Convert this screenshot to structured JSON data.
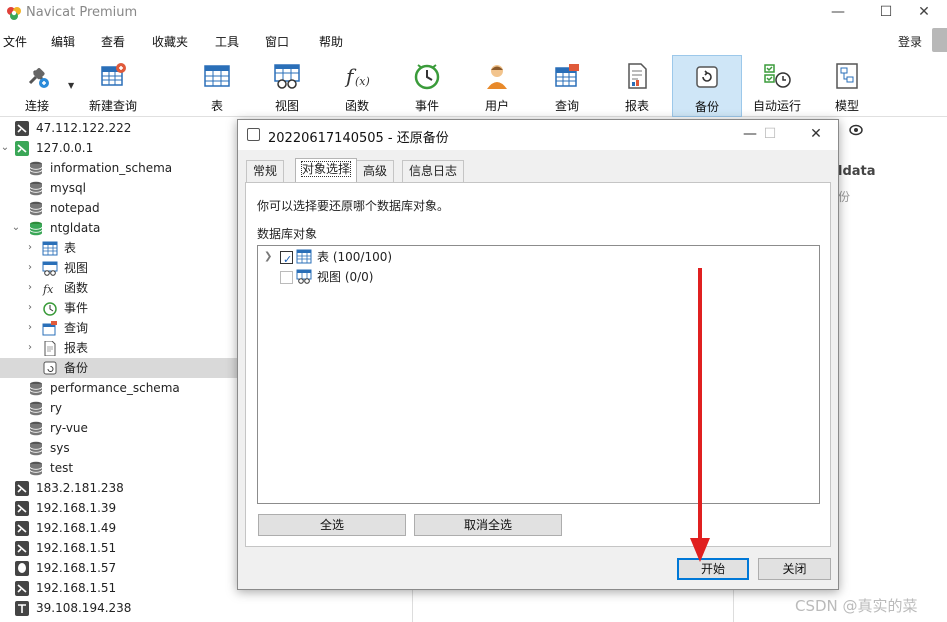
{
  "app": {
    "title": "Navicat Premium"
  },
  "window_controls": {
    "minimize": "—",
    "maximize": "☐",
    "close": "✕"
  },
  "menu": [
    "文件",
    "编辑",
    "查看",
    "收藏夹",
    "工具",
    "窗口",
    "帮助"
  ],
  "login": "登录",
  "toolbar": [
    {
      "label": "连接",
      "icon": "connect-icon"
    },
    {
      "label": "新建查询",
      "icon": "new-query-icon"
    },
    {
      "label": "表",
      "icon": "table-icon"
    },
    {
      "label": "视图",
      "icon": "view-icon"
    },
    {
      "label": "函数",
      "icon": "function-icon"
    },
    {
      "label": "事件",
      "icon": "event-icon"
    },
    {
      "label": "用户",
      "icon": "user-icon"
    },
    {
      "label": "查询",
      "icon": "query-icon"
    },
    {
      "label": "报表",
      "icon": "report-icon"
    },
    {
      "label": "备份",
      "icon": "backup-icon",
      "active": true
    },
    {
      "label": "自动运行",
      "icon": "automation-icon"
    },
    {
      "label": "模型",
      "icon": "model-icon"
    }
  ],
  "sidebar": {
    "items": [
      {
        "label": "47.112.122.222",
        "kind": "server",
        "level": 0
      },
      {
        "label": "127.0.0.1",
        "kind": "server-open",
        "level": 0,
        "expanded": true
      },
      {
        "label": "information_schema",
        "kind": "db",
        "level": 1
      },
      {
        "label": "mysql",
        "kind": "db",
        "level": 1
      },
      {
        "label": "notepad",
        "kind": "db",
        "level": 1
      },
      {
        "label": "ntgldata",
        "kind": "db-open",
        "level": 1,
        "expanded": true
      },
      {
        "label": "表",
        "kind": "table",
        "level": 2
      },
      {
        "label": "视图",
        "kind": "view",
        "level": 2
      },
      {
        "label": "函数",
        "kind": "function",
        "level": 2
      },
      {
        "label": "事件",
        "kind": "event",
        "level": 2
      },
      {
        "label": "查询",
        "kind": "query",
        "level": 2
      },
      {
        "label": "报表",
        "kind": "report",
        "level": 2
      },
      {
        "label": "备份",
        "kind": "backup",
        "level": 2,
        "selected": true
      },
      {
        "label": "performance_schema",
        "kind": "db",
        "level": 1
      },
      {
        "label": "ry",
        "kind": "db",
        "level": 1
      },
      {
        "label": "ry-vue",
        "kind": "db",
        "level": 1
      },
      {
        "label": "sys",
        "kind": "db",
        "level": 1
      },
      {
        "label": "test",
        "kind": "db",
        "level": 1
      },
      {
        "label": "183.2.181.238",
        "kind": "server",
        "level": 0
      },
      {
        "label": "192.168.1.39",
        "kind": "server",
        "level": 0
      },
      {
        "label": "192.168.1.49",
        "kind": "server",
        "level": 0
      },
      {
        "label": "192.168.1.51",
        "kind": "server",
        "level": 0
      },
      {
        "label": "192.168.1.57",
        "kind": "server-pg",
        "level": 0
      },
      {
        "label": "192.168.1.51",
        "kind": "server",
        "level": 0
      },
      {
        "label": "39.108.194.238",
        "kind": "server-alt",
        "level": 0
      }
    ]
  },
  "right_panel": {
    "name": "ldata",
    "sub": "份"
  },
  "dialog": {
    "title": "20220617140505 - 还原备份",
    "tabs": [
      "常规",
      "对象选择",
      "高级",
      "信息日志"
    ],
    "active_tab": 1,
    "hint": "你可以选择要还原哪个数据库对象。",
    "group_label": "数据库对象",
    "objects": [
      {
        "label": "表 (100/100)",
        "checked": true,
        "expandable": true,
        "icon": "table-icon"
      },
      {
        "label": "视图 (0/0)",
        "checked": false,
        "expandable": false,
        "icon": "view-icon"
      }
    ],
    "select_all": "全选",
    "deselect_all": "取消全选",
    "start": "开始",
    "close": "关闭"
  },
  "watermark": "CSDN @真实的菜",
  "colors": {
    "accent": "#0078d7",
    "toolbar_active": "#cfe6f7",
    "arrow": "#e02020"
  }
}
